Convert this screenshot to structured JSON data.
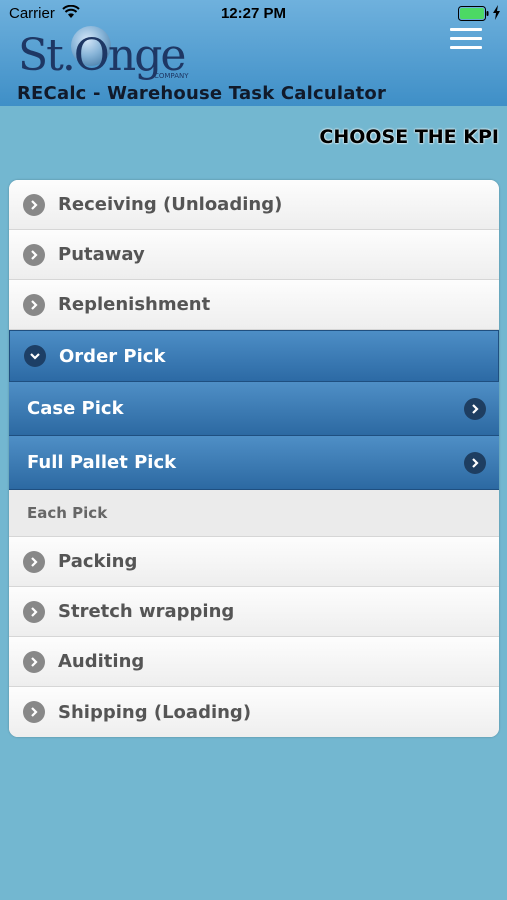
{
  "status_bar": {
    "carrier": "Carrier",
    "time": "12:27 PM"
  },
  "header": {
    "logo_text": "St.Onge",
    "logo_sub": "COMPANY",
    "app_title": "RECalc - Warehouse Task Calculator"
  },
  "heading": "CHOOSE THE KPI",
  "list": {
    "receiving": "Receiving (Unloading)",
    "putaway": "Putaway",
    "replenishment": "Replenishment",
    "order_pick": "Order Pick",
    "case_pick": "Case Pick",
    "full_pallet_pick": "Full Pallet Pick",
    "each_pick": "Each Pick",
    "packing": "Packing",
    "stretch_wrapping": "Stretch wrapping",
    "auditing": "Auditing",
    "shipping": "Shipping (Loading)"
  }
}
